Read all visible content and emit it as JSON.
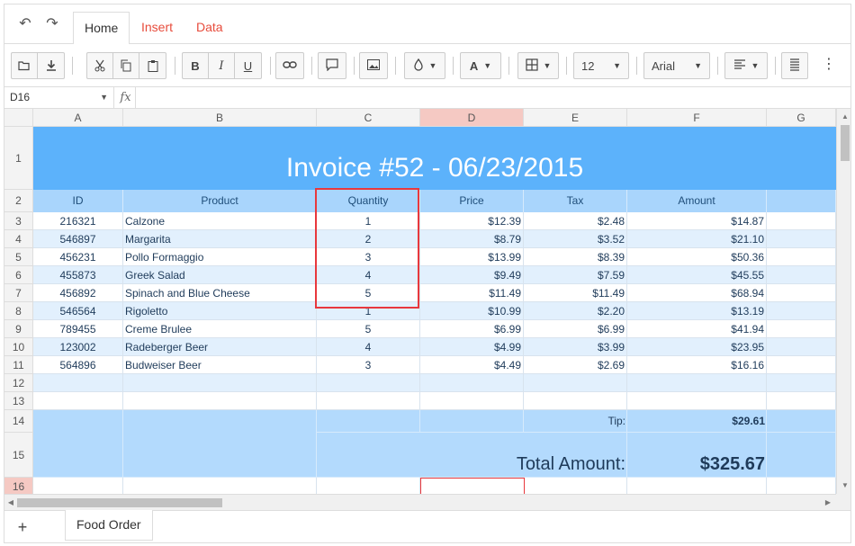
{
  "ribbon": {
    "tabs": [
      {
        "label": "Home"
      },
      {
        "label": "Insert"
      },
      {
        "label": "Data"
      }
    ]
  },
  "toolbar": {
    "font_size": "12",
    "font_family": "Arial",
    "font_color_letter": "A",
    "icons": [
      "open-icon",
      "download-icon",
      "cut-icon",
      "copy-icon",
      "paste-icon",
      "bold-icon",
      "italic-icon",
      "underline-icon",
      "link-icon",
      "comment-icon",
      "image-icon",
      "fill-color-icon",
      "font-color-icon",
      "borders-icon",
      "align-icon",
      "wrap-icon",
      "more-icon"
    ]
  },
  "formula_bar": {
    "cell_ref": "D16",
    "fx": "fx",
    "value": ""
  },
  "columns": [
    "A",
    "B",
    "C",
    "D",
    "E",
    "F",
    "G"
  ],
  "rows": [
    "1",
    "2",
    "3",
    "4",
    "5",
    "6",
    "7",
    "8",
    "9",
    "10",
    "11",
    "12",
    "13",
    "14",
    "15",
    "16"
  ],
  "sheet": {
    "title": "Invoice #52 - 06/23/2015",
    "headers": [
      "ID",
      "Product",
      "Quantity",
      "Price",
      "Tax",
      "Amount"
    ],
    "data": [
      [
        "216321",
        "Calzone",
        "1",
        "$12.39",
        "$2.48",
        "$14.87"
      ],
      [
        "546897",
        "Margarita",
        "2",
        "$8.79",
        "$3.52",
        "$21.10"
      ],
      [
        "456231",
        "Pollo Formaggio",
        "3",
        "$13.99",
        "$8.39",
        "$50.36"
      ],
      [
        "455873",
        "Greek Salad",
        "4",
        "$9.49",
        "$7.59",
        "$45.55"
      ],
      [
        "456892",
        "Spinach and Blue Cheese",
        "5",
        "$11.49",
        "$11.49",
        "$68.94"
      ],
      [
        "546564",
        "Rigoletto",
        "1",
        "$10.99",
        "$2.20",
        "$13.19"
      ],
      [
        "789455",
        "Creme Brulee",
        "5",
        "$6.99",
        "$6.99",
        "$41.94"
      ],
      [
        "123002",
        "Radeberger Beer",
        "4",
        "$4.99",
        "$3.99",
        "$23.95"
      ],
      [
        "564896",
        "Budweiser Beer",
        "3",
        "$4.49",
        "$2.69",
        "$16.16"
      ]
    ],
    "tip_label": "Tip:",
    "tip_value": "$29.61",
    "total_label": "Total Amount:",
    "total_value": "$325.67"
  },
  "sheet_tabs": [
    {
      "label": "Food Order"
    }
  ],
  "colors": {
    "accent": "#e74c3c",
    "title_band": "#5cb2fb",
    "header_band": "#a9d5fc",
    "footer_band": "#b3dafd",
    "alt_row": "#e2f0fd",
    "highlight": "#e8383d"
  }
}
